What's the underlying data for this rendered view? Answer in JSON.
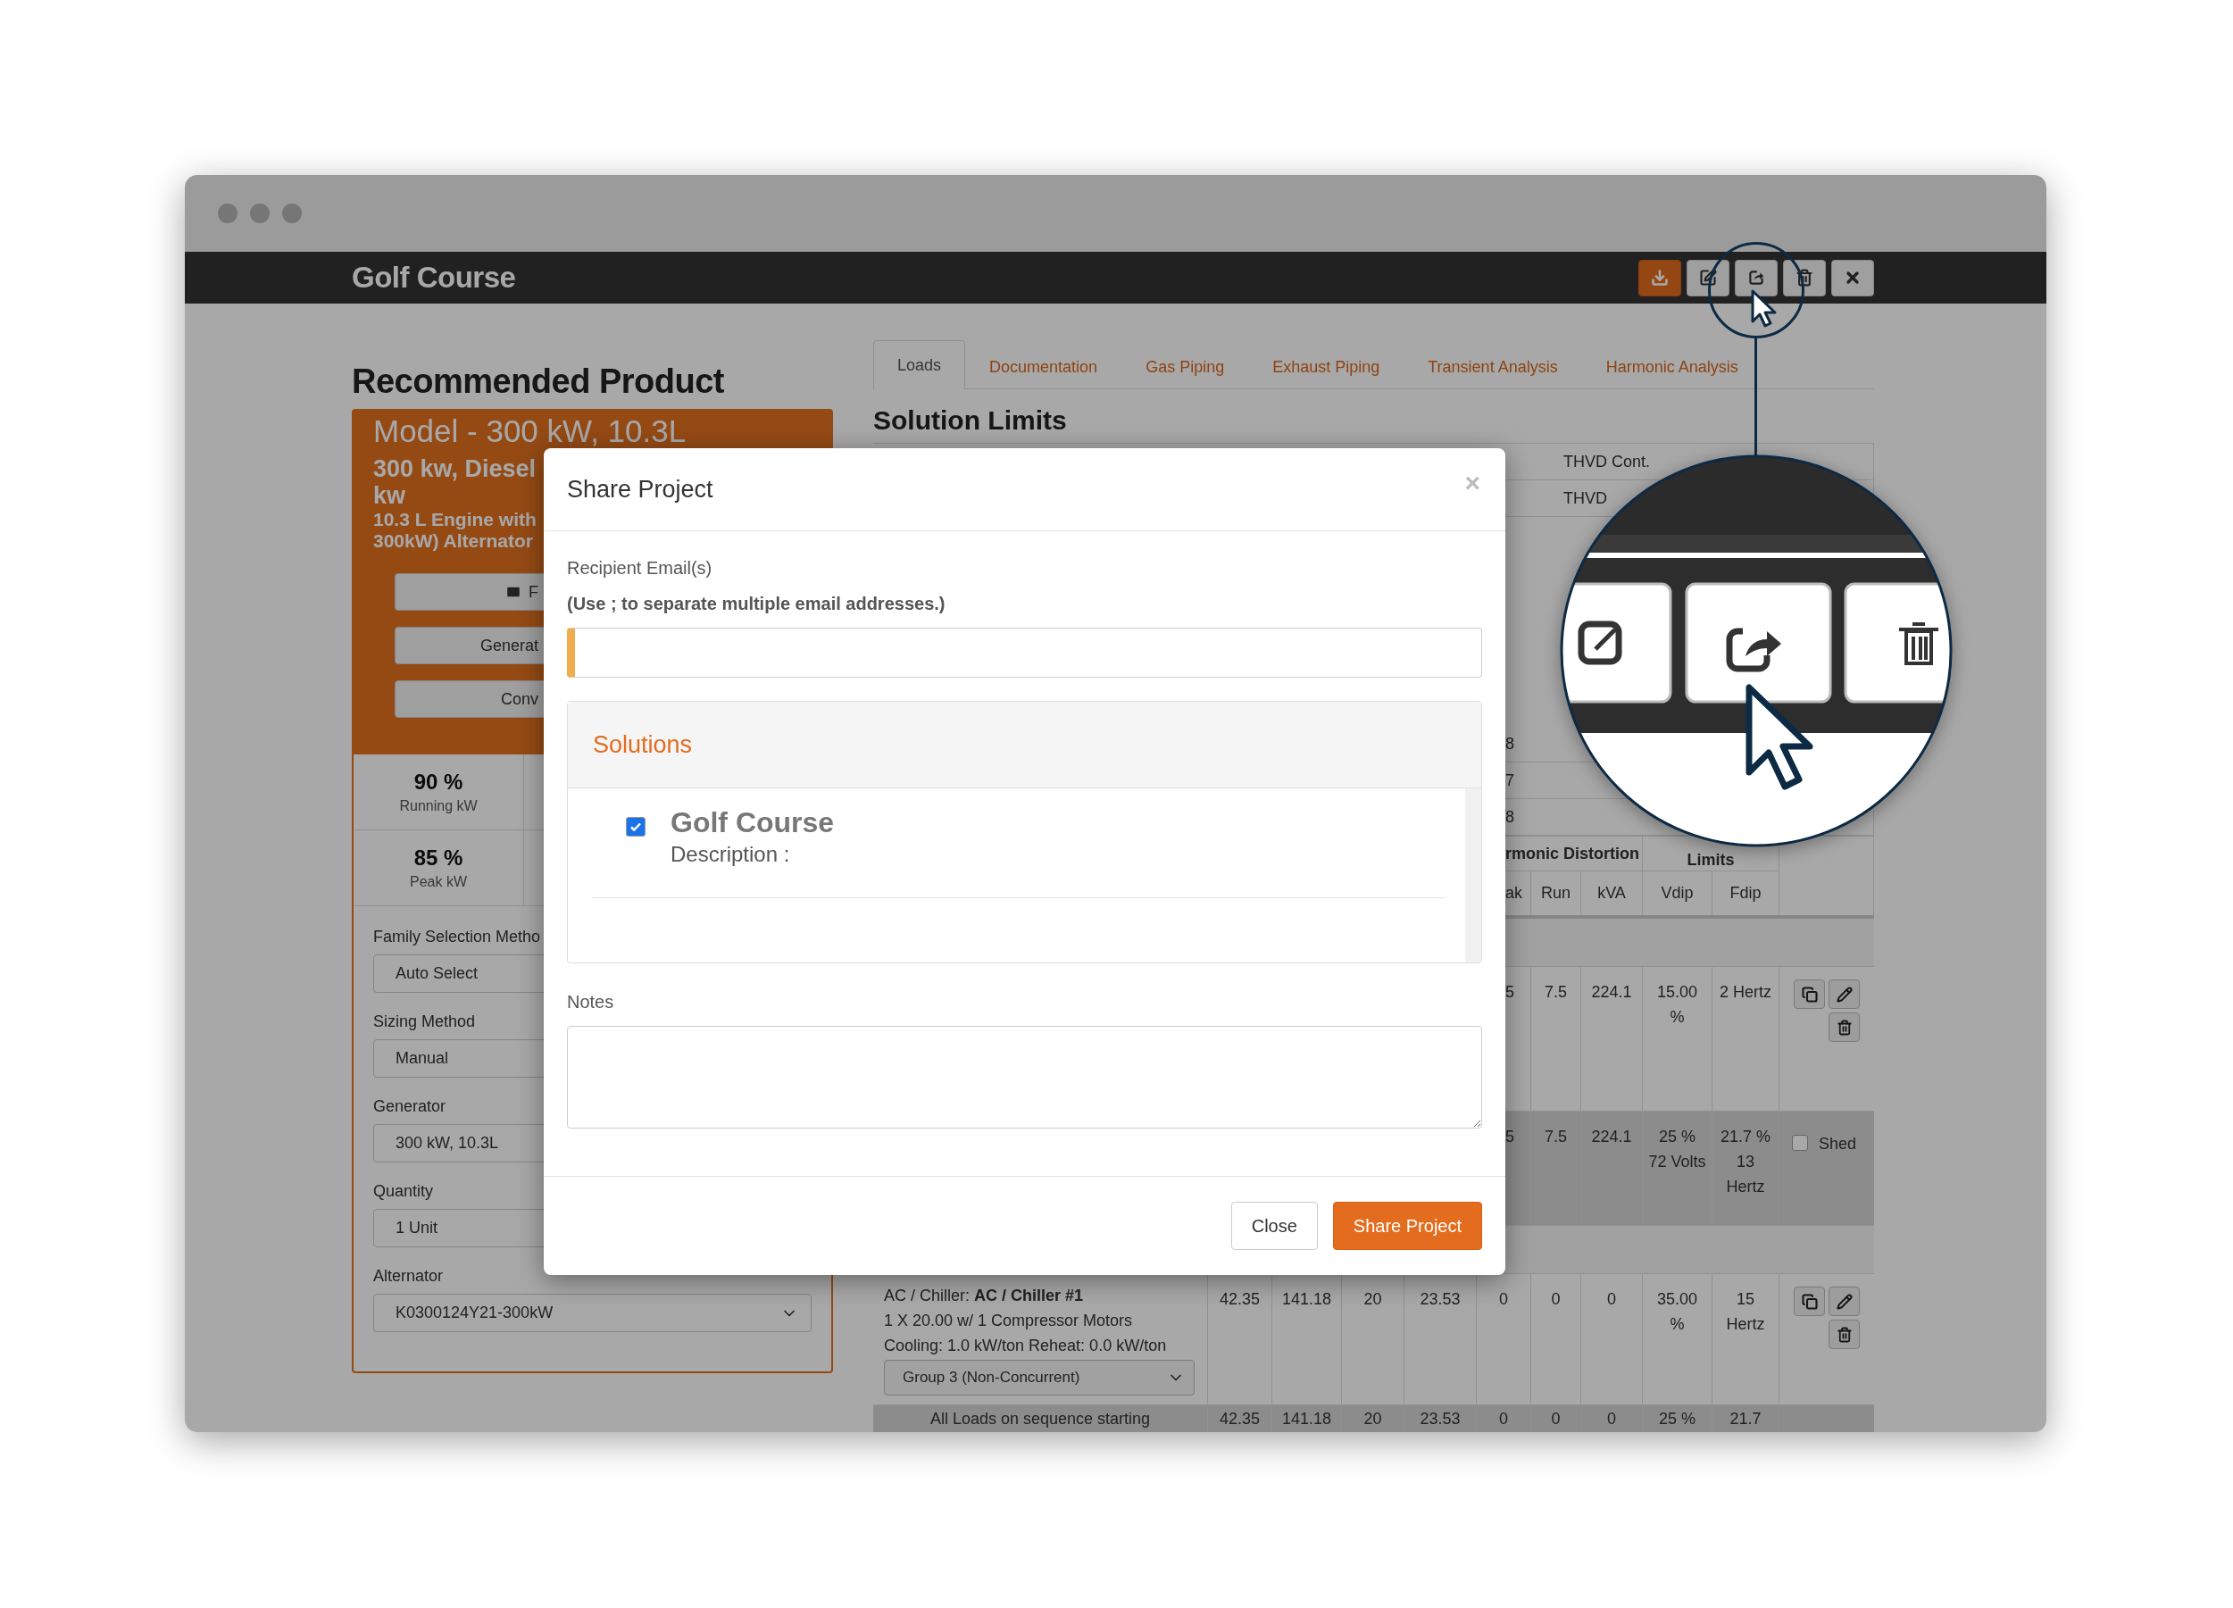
{
  "window": {
    "title": "Golf Course",
    "toolbar": [
      {
        "highlighted": true
      },
      {
        "highlighted": false
      },
      {
        "highlighted": false
      },
      {
        "highlighted": false
      },
      {
        "highlighted": false
      }
    ]
  },
  "product": {
    "heading": "Recommended Product",
    "model": "Model - 300 kW, 10.3L",
    "subtitle_lines": [
      "300 kw, Diesel",
      "kw"
    ],
    "engine_lines": [
      "10.3 L Engine with",
      "300kW) Alternator"
    ],
    "buttons": [
      {
        "label": "F"
      },
      {
        "label": "Generat"
      },
      {
        "label": "Conv"
      }
    ],
    "stats": [
      {
        "value": "90 %",
        "label": "Running kW"
      },
      {
        "value": "85 %",
        "label": "Peak kW"
      }
    ],
    "fields": [
      {
        "label": "Family Selection Metho",
        "value": "Auto Select",
        "kind": "text"
      },
      {
        "label": "Sizing Method",
        "value": "Manual",
        "kind": "text"
      },
      {
        "label": "Generator",
        "value": "300 kW, 10.3L",
        "kind": "text"
      },
      {
        "label": "Quantity",
        "value": "1 Unit",
        "kind": "text"
      },
      {
        "label": "Alternator",
        "value": "K0300124Y21-300kW",
        "kind": "select"
      }
    ]
  },
  "tabs": [
    {
      "label": "Loads",
      "selected": true
    },
    {
      "label": "Documentation",
      "selected": false
    },
    {
      "label": "Gas Piping",
      "selected": false
    },
    {
      "label": "Exhaust Piping",
      "selected": false
    },
    {
      "label": "Transient Analysis",
      "selected": false
    },
    {
      "label": "Harmonic Analysis",
      "selected": false
    }
  ],
  "solution_limits": {
    "title": "Solution Limits",
    "upper_rows": [
      "THVD Cont.",
      "THVD"
    ],
    "lower_rows": [
      "8",
      "7",
      "8"
    ]
  },
  "table": {
    "group_headers": {
      "harmonic": "rmonic Distortion",
      "limits": "Limits"
    },
    "columns": [
      "ak",
      "Run",
      "kVA",
      "Vdip",
      "Fdip"
    ],
    "rows": [
      {
        "kind": "load",
        "values": [
          "5",
          "7.5",
          "224.1",
          "15.00 %",
          "2 Hertz"
        ],
        "actions": true
      },
      {
        "kind": "summary",
        "values": [
          "5",
          "7.5",
          "224.1",
          "25 % 72 Volts",
          "21.7 % 13 Hertz"
        ],
        "shed": {
          "label": "Shed",
          "checked": false
        }
      },
      {
        "kind": "load",
        "title": "AC / Chiller: **AC / Chiller #1**",
        "details": [
          "1 X 20.00 w/ 1 Compressor Motors",
          "Cooling: 1.0 kW/ton Reheat: 0.0 kW/ton"
        ],
        "group": "Group 3 (Non-Concurrent)",
        "values": [
          "42.35",
          "141.18",
          "20",
          "23.53",
          "0",
          "0",
          "0",
          "35.00 %",
          "15 Hertz"
        ],
        "actions": true
      },
      {
        "kind": "summary",
        "title": "All Loads on sequence starting",
        "values": [
          "42.35",
          "141.18",
          "20",
          "23.53",
          "0",
          "0",
          "0",
          "25 %",
          "21.7"
        ]
      }
    ]
  },
  "modal": {
    "title": "Share Project",
    "close_glyph": "×",
    "email_label": "Recipient Email(s)",
    "email_hint": "(Use ; to separate multiple email addresses.)",
    "solutions_heading": "Solutions",
    "solutions": [
      {
        "name": "Golf Course",
        "description": "Description :",
        "checked": true
      }
    ],
    "notes_label": "Notes",
    "buttons": [
      {
        "label": "Close",
        "primary": false
      },
      {
        "label": "Share Project",
        "primary": true
      }
    ]
  }
}
